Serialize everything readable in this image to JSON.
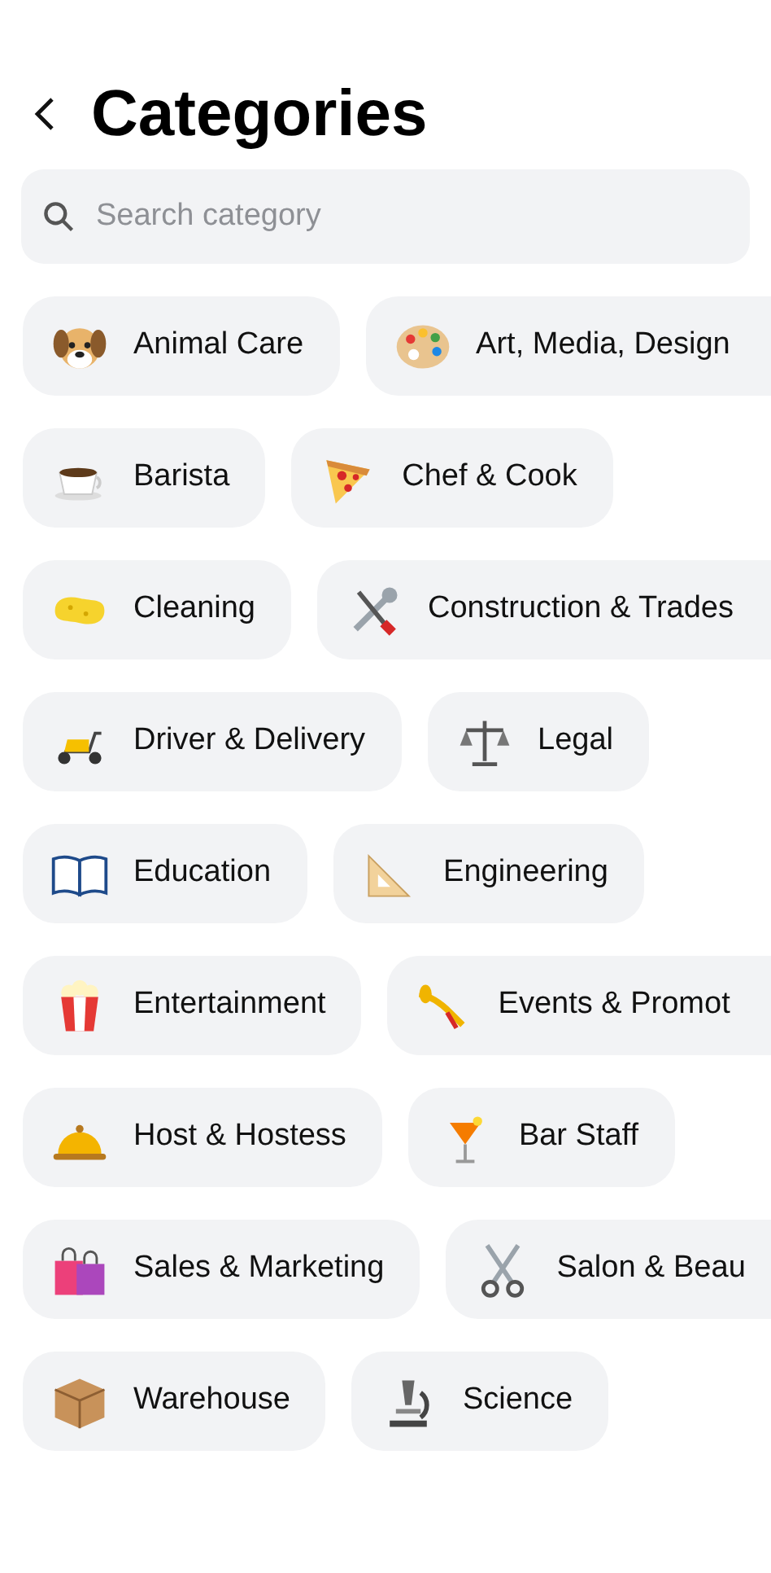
{
  "header": {
    "title": "Categories"
  },
  "search": {
    "placeholder": "Search category"
  },
  "rows": [
    {
      "chips": [
        {
          "label": "Animal Care",
          "cut_off": false
        },
        {
          "label": "Art, Media, Design",
          "cut_off": true
        }
      ]
    },
    {
      "chips": [
        {
          "label": "Barista",
          "cut_off": false
        },
        {
          "label": "Chef & Cook",
          "cut_off": false
        }
      ]
    },
    {
      "chips": [
        {
          "label": "Cleaning",
          "cut_off": false
        },
        {
          "label": "Construction & Trades",
          "cut_off": true
        }
      ]
    },
    {
      "chips": [
        {
          "label": "Driver & Delivery",
          "cut_off": false
        },
        {
          "label": "Legal",
          "cut_off": false
        }
      ]
    },
    {
      "chips": [
        {
          "label": "Education",
          "cut_off": false
        },
        {
          "label": "Engineering",
          "cut_off": false
        }
      ]
    },
    {
      "chips": [
        {
          "label": "Entertainment",
          "cut_off": false
        },
        {
          "label": "Events & Promot",
          "cut_off": true
        }
      ]
    },
    {
      "chips": [
        {
          "label": "Host & Hostess",
          "cut_off": false
        },
        {
          "label": "Bar Staff",
          "cut_off": false
        }
      ]
    },
    {
      "chips": [
        {
          "label": "Sales & Marketing",
          "cut_off": false
        },
        {
          "label": "Salon & Beau",
          "cut_off": true
        }
      ]
    },
    {
      "chips": [
        {
          "label": "Warehouse",
          "cut_off": false
        },
        {
          "label": "Science",
          "cut_off": false
        }
      ]
    }
  ]
}
